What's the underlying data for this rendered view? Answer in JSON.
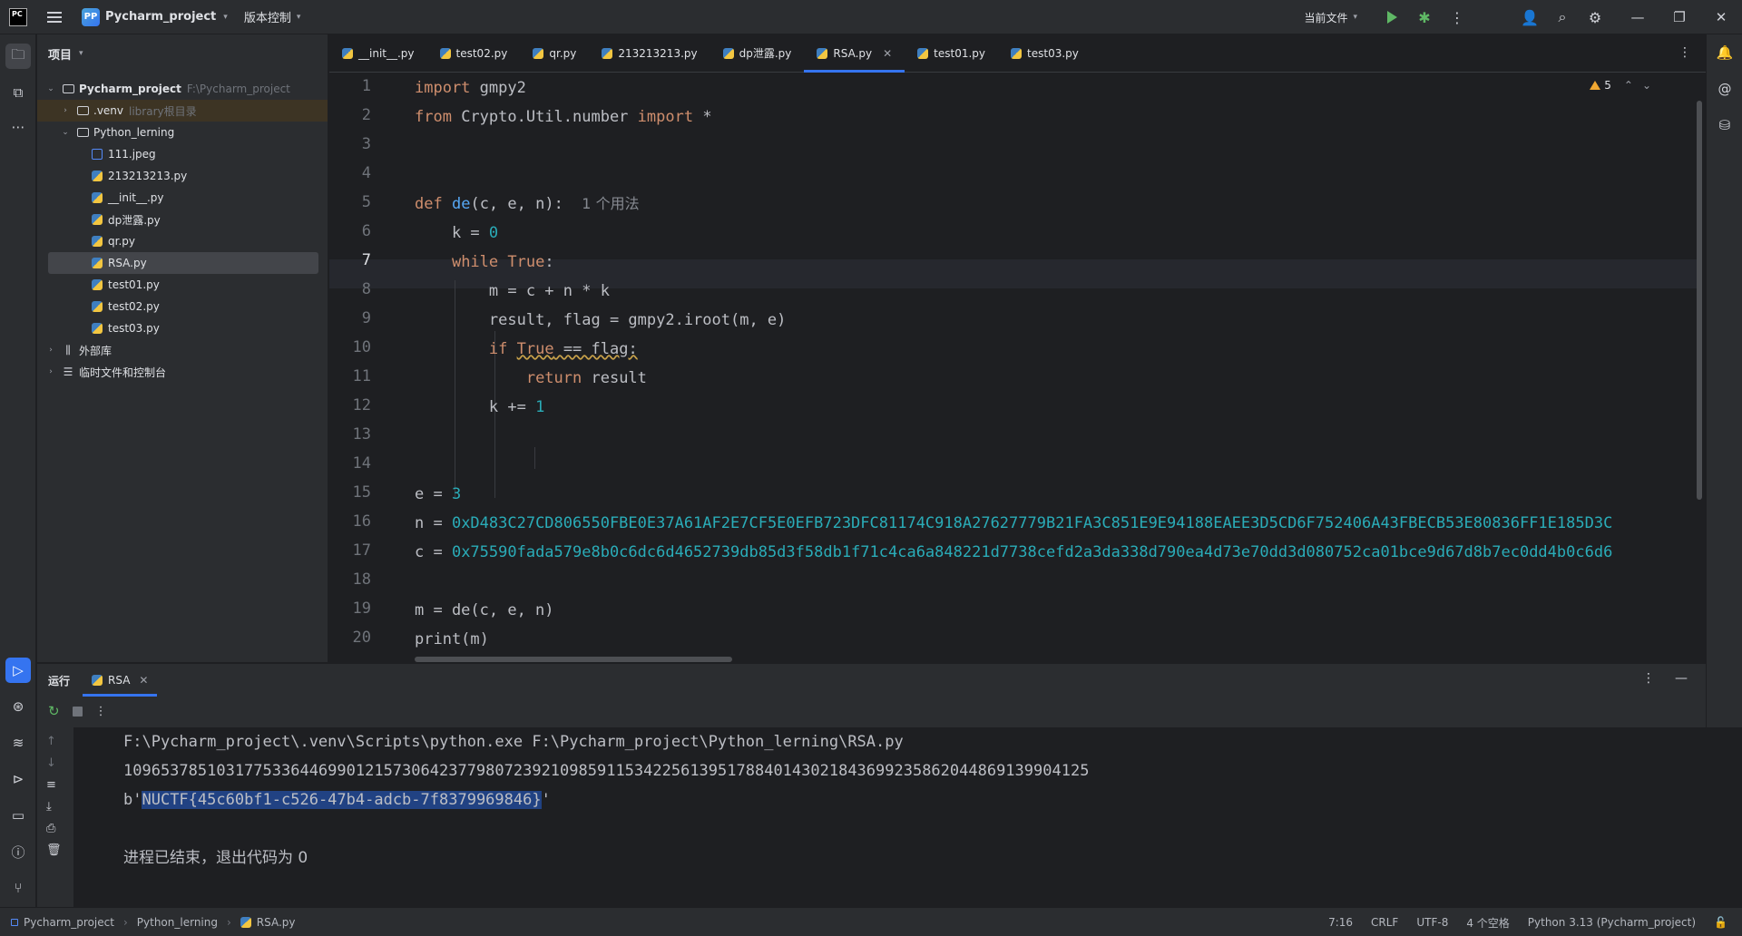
{
  "titlebar": {
    "logo": "PC",
    "project_badge": "PP",
    "project_name": "Pycharm_project",
    "vcs_label": "版本控制",
    "current_file": "当前文件"
  },
  "project_panel": {
    "header": "项目",
    "tree": [
      {
        "label": "Pycharm_project",
        "hint": "F:\\Pycharm_project",
        "depth": 0,
        "type": "folder",
        "expanded": true
      },
      {
        "label": ".venv",
        "hint": "library根目录",
        "depth": 1,
        "type": "folder",
        "expanded": false
      },
      {
        "label": "Python_lerning",
        "hint": "",
        "depth": 1,
        "type": "folder",
        "expanded": true
      },
      {
        "label": "111.jpeg",
        "hint": "",
        "depth": 2,
        "type": "image"
      },
      {
        "label": "213213213.py",
        "hint": "",
        "depth": 2,
        "type": "python"
      },
      {
        "label": "__init__.py",
        "hint": "",
        "depth": 2,
        "type": "python"
      },
      {
        "label": "dp泄露.py",
        "hint": "",
        "depth": 2,
        "type": "python"
      },
      {
        "label": "qr.py",
        "hint": "",
        "depth": 2,
        "type": "python"
      },
      {
        "label": "RSA.py",
        "hint": "",
        "depth": 2,
        "type": "python",
        "selected": true
      },
      {
        "label": "test01.py",
        "hint": "",
        "depth": 2,
        "type": "python"
      },
      {
        "label": "test02.py",
        "hint": "",
        "depth": 2,
        "type": "python"
      },
      {
        "label": "test03.py",
        "hint": "",
        "depth": 2,
        "type": "python"
      },
      {
        "label": "外部库",
        "hint": "",
        "depth": 0,
        "type": "library",
        "expanded": false
      },
      {
        "label": "临时文件和控制台",
        "hint": "",
        "depth": 0,
        "type": "scratch",
        "expanded": false
      }
    ]
  },
  "tabs": [
    {
      "label": "__init__.py"
    },
    {
      "label": "test02.py"
    },
    {
      "label": "qr.py"
    },
    {
      "label": "213213213.py"
    },
    {
      "label": "dp泄露.py"
    },
    {
      "label": "RSA.py",
      "active": true
    },
    {
      "label": "test01.py"
    },
    {
      "label": "test03.py"
    }
  ],
  "editor": {
    "warning_count": "5",
    "current_line": 7,
    "line_numbers": [
      "1",
      "2",
      "3",
      "4",
      "5",
      "6",
      "7",
      "8",
      "9",
      "10",
      "11",
      "12",
      "13",
      "14",
      "15",
      "16",
      "17",
      "18",
      "19",
      "20"
    ],
    "lines": {
      "l1_kw": "import",
      "l1_rest": " gmpy2",
      "l2_kw1": "from",
      "l2_mid": " Crypto.Util.number ",
      "l2_kw2": "import",
      "l2_rest": " *",
      "l5_kw": "def",
      "l5_fn": "de",
      "l5_args": "(c, e, n):",
      "l5_inlay": "1 个用法",
      "l6_code": "k = ",
      "l6_num": "0",
      "l7_kw1": "while",
      "l7_kw2": "True",
      "l7_rest": ":",
      "l8_code": "m = c + n * k",
      "l9_code": "result, flag = gmpy2.iroot(m, e)",
      "l10_kw": "if",
      "l10_kw2": "True",
      "l10_rest": " == flag:",
      "l11_kw": "return",
      "l11_rest": " result",
      "l12_code": "k += ",
      "l12_num": "1",
      "l15_code": "e = ",
      "l15_num": "3",
      "l16_code": "n = ",
      "l16_num": "0xD483C27CD806550FBE0E37A61AF2E7CF5E0EFB723DFC81174C918A27627779B21FA3C851E9E94188EAEE3D5CD6F752406A43FBECB53E80836FF1E185D3C",
      "l17_code": "c = ",
      "l17_num": "0x75590fada579e8b0c6dc6d4652739db85d3f58db1f71c4ca6a848221d7738cefd2a3da338d790ea4d73e70dd3d080752ca01bce9d67d8b7ec0dd4b0c6d6",
      "l19_code": "m = de(c, e, n)",
      "l20_code": "print(m)"
    }
  },
  "run_panel": {
    "title": "运行",
    "tab_label": "RSA",
    "console": {
      "command": "F:\\Pycharm_project\\.venv\\Scripts\\python.exe F:\\Pycharm_project\\Python_lerning\\RSA.py",
      "number": "1096537851031775336446990121573064237798072392109859115342256139517884014302184369923586204486913990412​5",
      "bytes_prefix": "b'",
      "flag": "NUCTF{45c60bf1-c526-47b4-adcb-7f8379969846}",
      "bytes_suffix": "'",
      "exit": "进程已结束，退出代码为 0"
    }
  },
  "statusbar": {
    "crumbs": [
      "Pycharm_project",
      "Python_lerning",
      "RSA.py"
    ],
    "position": "7:16",
    "line_ending": "CRLF",
    "encoding": "UTF-8",
    "indent": "4 个空格",
    "interpreter": "Python 3.13 (Pycharm_project)"
  }
}
